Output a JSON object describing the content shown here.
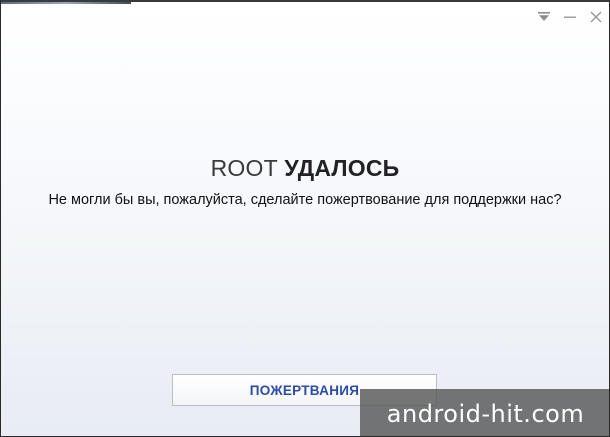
{
  "window": {
    "controls": {
      "menu_icon": "dropdown-triangle-icon",
      "minimize_icon": "minimize-icon",
      "close_icon": "close-icon"
    }
  },
  "main": {
    "title_light": "ROOT",
    "title_bold": "УДАЛОСЬ",
    "message": "Не могли бы вы, пожалуйста, сделайте пожертвование для поддержки нас?"
  },
  "actions": {
    "donate_label": "ПОЖЕРТВАНИЯ"
  },
  "watermark": {
    "text": "android-hit.com"
  },
  "colors": {
    "accent": "#2d4aa8",
    "text": "#111111",
    "border": "#b8bec8",
    "watermark_bg": "#585858"
  }
}
